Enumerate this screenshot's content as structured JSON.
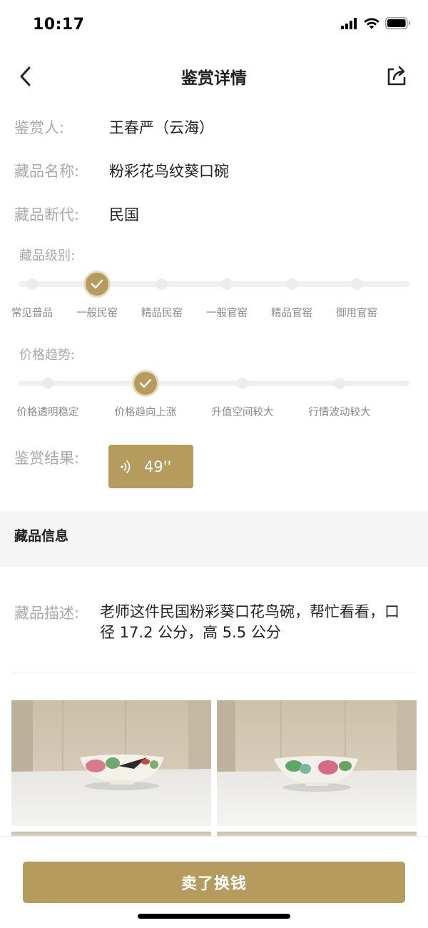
{
  "status_bar": {
    "time": "10:17"
  },
  "nav": {
    "title": "鉴赏详情"
  },
  "details": {
    "appraiser_label": "鉴赏人:",
    "appraiser_value": "王春严（云海）",
    "name_label": "藏品名称:",
    "name_value": "粉彩花鸟纹葵口碗",
    "era_label": "藏品断代:",
    "era_value": "民国"
  },
  "grade": {
    "label": "藏品级别:",
    "options": [
      "常见普品",
      "一般民窑",
      "精品民窑",
      "一般官窑",
      "精品官窑",
      "御用官窑"
    ],
    "selected": "一般民窑"
  },
  "price_trend": {
    "label": "价格趋势:",
    "options": [
      "价格透明稳定",
      "价格趋向上涨",
      "升值空间较大",
      "行情波动较大"
    ],
    "selected": "价格趋向上涨"
  },
  "result": {
    "label": "鉴赏结果:",
    "audio_duration": "49''"
  },
  "collection_info": {
    "title": "藏品信息",
    "desc_label": "藏品描述:",
    "desc_text": "老师这件民国粉彩葵口花鸟碗，帮忙看看，口径 17.2 公分，高 5.5 公分"
  },
  "actions": {
    "sell_label": "卖了换钱"
  },
  "colors": {
    "accent": "#b59c5e",
    "label_gray": "#a8a8a8",
    "section_bg": "#f5f5f5"
  },
  "icons": {
    "back": "chevron-left-icon",
    "share": "share-icon",
    "audio": "sound-wave-icon",
    "check": "check-icon"
  }
}
